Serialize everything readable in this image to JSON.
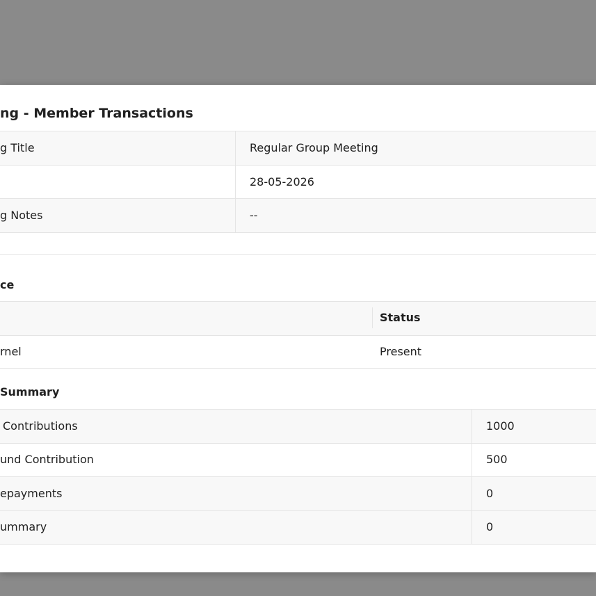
{
  "dialog": {
    "title": "ng - Member Transactions"
  },
  "meeting_details": [
    {
      "label": "g Title",
      "value": "Regular Group Meeting"
    },
    {
      "label": "",
      "value": "28-05-2026"
    },
    {
      "label": "g Notes",
      "value": "--"
    }
  ],
  "attendance": {
    "section_title": "ce",
    "headers": {
      "name": "",
      "status": "Status"
    },
    "rows": [
      {
        "name": "rnel",
        "status": "Present"
      }
    ]
  },
  "summary": {
    "section_title": "Summary",
    "rows": [
      {
        "label": "Contributions",
        "value": "1000"
      },
      {
        "label": "und Contribution",
        "value": "500"
      },
      {
        "label": "epayments",
        "value": "0"
      },
      {
        "label": "ummary",
        "value": "0"
      }
    ]
  }
}
